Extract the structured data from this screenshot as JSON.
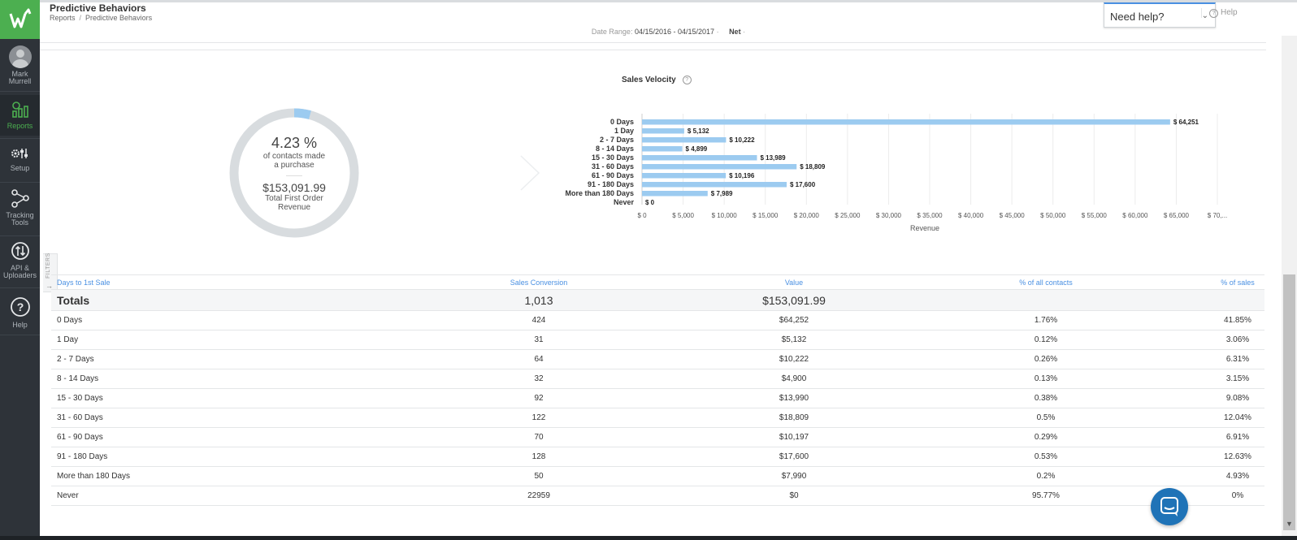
{
  "sidebar": {
    "user": "Mark Murrell",
    "items": [
      {
        "label": "Reports"
      },
      {
        "label": "Setup"
      },
      {
        "label": "Tracking Tools"
      },
      {
        "label": "API & Uploaders"
      },
      {
        "label": "Help"
      }
    ]
  },
  "header": {
    "title": "Predictive Behaviors",
    "breadcrumb": [
      "Reports",
      "Predictive Behaviors"
    ],
    "need_help": "Need help?",
    "help_link": "Help"
  },
  "date_range": {
    "label": "Date Range:",
    "value": "04/15/2016 - 04/15/2017",
    "mode": "Net"
  },
  "summary": {
    "percent": "4.23 %",
    "percent_label_1": "of contacts made",
    "percent_label_2": "a purchase",
    "percent_fraction": 0.0423,
    "revenue": "$153,091.99",
    "revenue_label_1": "Total First Order",
    "revenue_label_2": "Revenue"
  },
  "filters_tab": "FILTERS",
  "chart_data": {
    "type": "bar",
    "title": "Sales Velocity",
    "orientation": "horizontal",
    "categories": [
      "0 Days",
      "1 Day",
      "2 - 7 Days",
      "8 - 14 Days",
      "15 - 30 Days",
      "31 - 60 Days",
      "61 - 90 Days",
      "91 - 180 Days",
      "More than 180 Days",
      "Never"
    ],
    "values": [
      64251,
      5132,
      10222,
      4899,
      13989,
      18809,
      10196,
      17600,
      7989,
      0
    ],
    "value_labels": [
      "$ 64,251",
      "$ 5,132",
      "$ 10,222",
      "$ 4,899",
      "$ 13,989",
      "$ 18,809",
      "$ 10,196",
      "$ 17,600",
      "$ 7,989",
      "$ 0"
    ],
    "xlabel": "Revenue",
    "xticks": [
      "$ 0",
      "$ 5,000",
      "$ 10,000",
      "$ 15,000",
      "$ 20,000",
      "$ 25,000",
      "$ 30,000",
      "$ 35,000",
      "$ 40,000",
      "$ 45,000",
      "$ 50,000",
      "$ 55,000",
      "$ 60,000",
      "$ 65,000",
      "$ 70,..."
    ],
    "xlim": [
      0,
      70000
    ],
    "grid": true,
    "color": "#9ccbf0"
  },
  "table": {
    "headers": [
      "Days to 1st Sale",
      "Sales Conversion",
      "Value",
      "% of all contacts",
      "% of sales"
    ],
    "totals": {
      "label": "Totals",
      "conversion": "1,013",
      "value": "$153,091.99"
    },
    "rows": [
      [
        "0 Days",
        "424",
        "$64,252",
        "1.76%",
        "41.85%"
      ],
      [
        "1 Day",
        "31",
        "$5,132",
        "0.12%",
        "3.06%"
      ],
      [
        "2 - 7 Days",
        "64",
        "$10,222",
        "0.26%",
        "6.31%"
      ],
      [
        "8 - 14 Days",
        "32",
        "$4,900",
        "0.13%",
        "3.15%"
      ],
      [
        "15 - 30 Days",
        "92",
        "$13,990",
        "0.38%",
        "9.08%"
      ],
      [
        "31 - 60 Days",
        "122",
        "$18,809",
        "0.5%",
        "12.04%"
      ],
      [
        "61 - 90 Days",
        "70",
        "$10,197",
        "0.29%",
        "6.91%"
      ],
      [
        "91 - 180 Days",
        "128",
        "$17,600",
        "0.53%",
        "12.63%"
      ],
      [
        "More than 180 Days",
        "50",
        "$7,990",
        "0.2%",
        "4.93%"
      ],
      [
        "Never",
        "22959",
        "$0",
        "95.77%",
        "0%"
      ]
    ]
  },
  "colors": {
    "brand": "#4caf50",
    "sidebar": "#2e3339",
    "accent": "#4a90e2",
    "bar": "#9ccbf0",
    "chat": "#1f73b7"
  },
  "icons": [
    "logo-icon",
    "reports-icon",
    "setup-icon",
    "tracking-tools-icon",
    "api-icon",
    "help-icon",
    "chat-icon"
  ]
}
